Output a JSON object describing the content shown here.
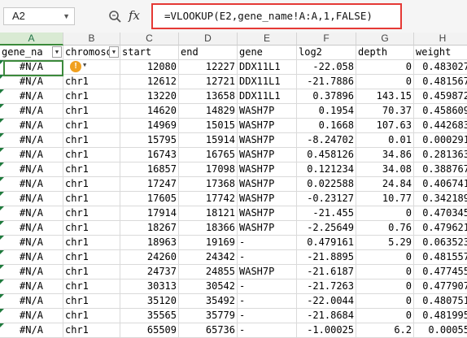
{
  "formula_bar": {
    "name_box": "A2",
    "fx_label": "fx",
    "formula": "=VLOOKUP(E2,gene_name!A:A,1,FALSE)"
  },
  "columns": [
    "A",
    "B",
    "C",
    "D",
    "E",
    "F",
    "G",
    "H"
  ],
  "selected_column": "A",
  "rows": [
    [
      "gene_na",
      "chromosom",
      "start",
      "end",
      "gene",
      "log2",
      "depth",
      "weight"
    ],
    [
      "#N/A",
      "",
      "12080",
      "12227",
      "DDX11L1",
      "-22.058",
      "0",
      "0.483027"
    ],
    [
      "#N/A",
      "chr1",
      "12612",
      "12721",
      "DDX11L1",
      "-21.7886",
      "0",
      "0.481567"
    ],
    [
      "#N/A",
      "chr1",
      "13220",
      "13658",
      "DDX11L1",
      "0.37896",
      "143.15",
      "0.459872"
    ],
    [
      "#N/A",
      "chr1",
      "14620",
      "14829",
      "WASH7P",
      "0.1954",
      "70.37",
      "0.458609"
    ],
    [
      "#N/A",
      "chr1",
      "14969",
      "15015",
      "WASH7P",
      "0.1668",
      "107.63",
      "0.442683"
    ],
    [
      "#N/A",
      "chr1",
      "15795",
      "15914",
      "WASH7P",
      "-8.24702",
      "0.01",
      "0.000291"
    ],
    [
      "#N/A",
      "chr1",
      "16743",
      "16765",
      "WASH7P",
      "0.458126",
      "34.86",
      "0.281363"
    ],
    [
      "#N/A",
      "chr1",
      "16857",
      "17098",
      "WASH7P",
      "0.121234",
      "34.08",
      "0.388767"
    ],
    [
      "#N/A",
      "chr1",
      "17247",
      "17368",
      "WASH7P",
      "0.022588",
      "24.84",
      "0.406741"
    ],
    [
      "#N/A",
      "chr1",
      "17605",
      "17742",
      "WASH7P",
      "-0.23127",
      "10.77",
      "0.342189"
    ],
    [
      "#N/A",
      "chr1",
      "17914",
      "18121",
      "WASH7P",
      "-21.455",
      "0",
      "0.470345"
    ],
    [
      "#N/A",
      "chr1",
      "18267",
      "18366",
      "WASH7P",
      "-2.25649",
      "0.76",
      "0.479621"
    ],
    [
      "#N/A",
      "chr1",
      "18963",
      "19169",
      "-",
      "0.479161",
      "5.29",
      "0.063523"
    ],
    [
      "#N/A",
      "chr1",
      "24260",
      "24342",
      "-",
      "-21.8895",
      "0",
      "0.481557"
    ],
    [
      "#N/A",
      "chr1",
      "24737",
      "24855",
      "WASH7P",
      "-21.6187",
      "0",
      "0.477455"
    ],
    [
      "#N/A",
      "chr1",
      "30313",
      "30542",
      "-",
      "-21.7263",
      "0",
      "0.477907"
    ],
    [
      "#N/A",
      "chr1",
      "35120",
      "35492",
      "-",
      "-22.0044",
      "0",
      "0.480751"
    ],
    [
      "#N/A",
      "chr1",
      "35565",
      "35779",
      "-",
      "-21.8684",
      "0",
      "0.481995"
    ],
    [
      "#N/A",
      "chr1",
      "65509",
      "65736",
      "-",
      "-1.00025",
      "6.2",
      "0.00055"
    ]
  ],
  "icons": {
    "warning": "!",
    "dropdown": "▼"
  },
  "colors": {
    "formula_highlight": "#e53935",
    "active_cell_border": "#3c8a3c",
    "error_indicator": "#1e7a3c",
    "warning": "#f0a020"
  }
}
